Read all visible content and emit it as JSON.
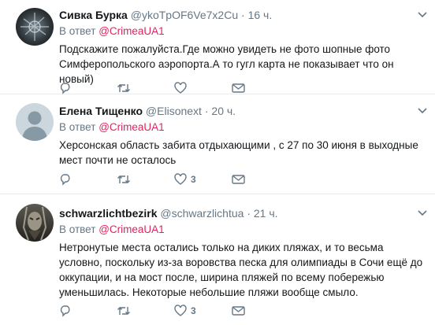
{
  "tweets": [
    {
      "name": "Сивка Бурка",
      "handle": "@ykoTpOF6Ve7x2Cu",
      "dot": "·",
      "time": "16 ч.",
      "reply_prefix": "В ответ",
      "reply_to": "@CrimeaUA1",
      "text": "Подскажите пожалуйста.Где можно увидеть не фото шопные фото Симферопольского аэропорта.А то гугл карта не показывает что он новый)",
      "like_count": "",
      "avatar": "dark-abstract-avatar"
    },
    {
      "name": "Елена Тищенко",
      "handle": "@Elisonext",
      "dot": "·",
      "time": "20 ч.",
      "reply_prefix": "В ответ",
      "reply_to": "@CrimeaUA1",
      "text": "Херсонская область забита отдыхающими , с 27 по 30 июня в выходные мест почти не осталось",
      "like_count": "3",
      "avatar": "default-avatar"
    },
    {
      "name": "schwarzlichtbezirk",
      "handle": "@schwarzlichtua",
      "dot": "·",
      "time": "21 ч.",
      "reply_prefix": "В ответ",
      "reply_to": "@CrimeaUA1",
      "text": "Нетронутые места остались только на диких пляжах, и то весьма условно, поскольку из-за воровства песка для олимпиады в Сочи ещё до оккупации, и на мост после, ширина пляжей по всему побережью уменьшилась. Некоторые небольшие пляжи вообще смыло.",
      "like_count": "3",
      "avatar": "dark-character-avatar"
    }
  ],
  "icons": {
    "reply": "reply-icon",
    "retweet": "retweet-icon",
    "like": "heart-icon",
    "dm": "envelope-icon",
    "caret": "chevron-down-icon"
  },
  "colors": {
    "mention": "#e0245e",
    "secondary": "#657786",
    "divider": "#e6ecf0"
  }
}
